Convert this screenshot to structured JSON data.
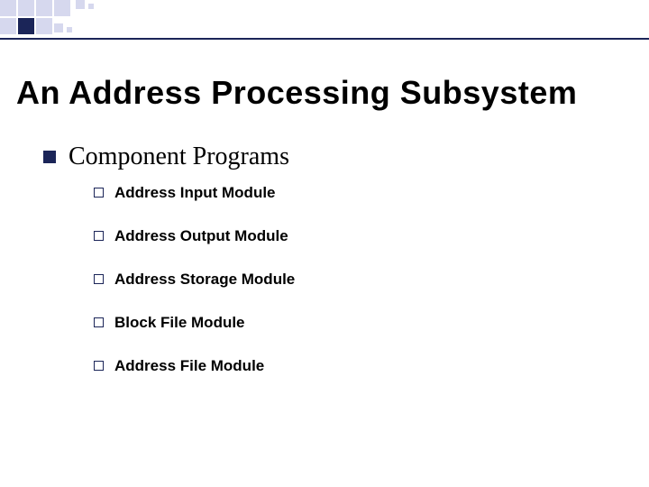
{
  "title": "An Address Processing Subsystem",
  "section": {
    "heading": "Component Programs",
    "items": [
      "Address Input Module",
      "Address Output Module",
      "Address Storage Module",
      "Block File Module",
      "Address File Module"
    ]
  },
  "colors": {
    "accent": "#1b2558",
    "text": "#000000",
    "bg": "#ffffff"
  }
}
